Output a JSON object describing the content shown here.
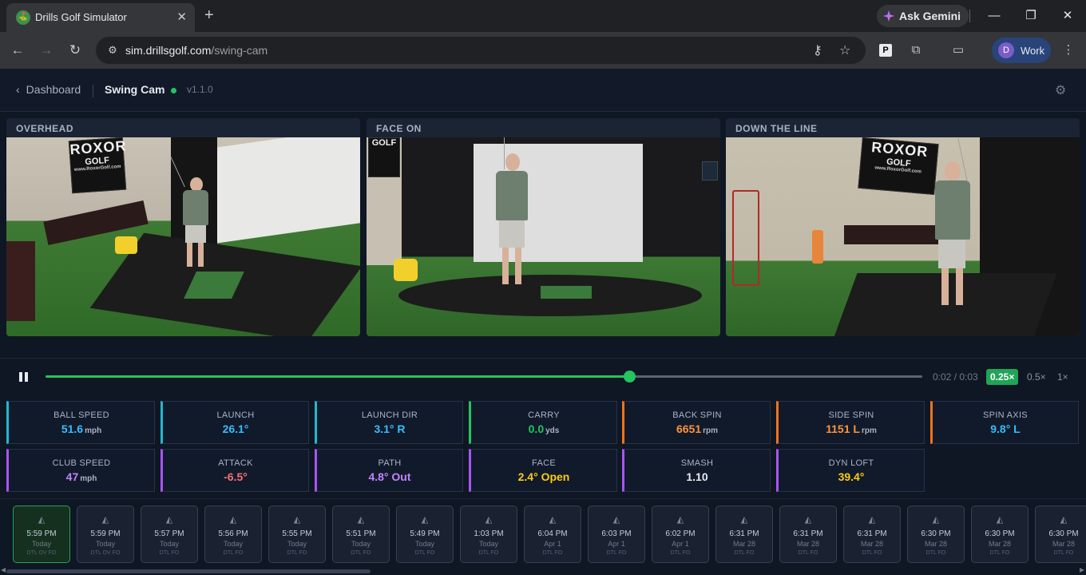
{
  "browser": {
    "tab_title": "Drills Golf Simulator",
    "favicon": "⛳",
    "ask_gemini": "Ask Gemini",
    "url_host": "sim.drillsgolf.com",
    "url_path": "/swing-cam",
    "profile_initial": "D",
    "profile_label": "Work",
    "ext_p": "P"
  },
  "header": {
    "back_label": "Dashboard",
    "title": "Swing Cam",
    "version": "v1.1.0",
    "status_color": "#22c55e"
  },
  "cameras": [
    {
      "label": "OVERHEAD"
    },
    {
      "label": "FACE ON"
    },
    {
      "label": "DOWN THE LINE"
    }
  ],
  "scene_text": {
    "brand": "ROXOR",
    "brand_sub": "GOLF",
    "brand_url": "www.RoxorGolf.com"
  },
  "playback": {
    "progress": 0.666,
    "timecode": "0:02 / 0:03",
    "rates": [
      "0.25×",
      "0.5×",
      "1×"
    ],
    "active_rate": "0.25×",
    "accent": "#22c55e"
  },
  "metrics": [
    {
      "label": "BALL SPEED",
      "value": "51.6",
      "unit": "mph",
      "color": "#38bdf8",
      "accent": "#22b8cf"
    },
    {
      "label": "LAUNCH",
      "value": "26.1°",
      "unit": "",
      "color": "#38bdf8",
      "accent": "#22b8cf"
    },
    {
      "label": "LAUNCH DIR",
      "value": "3.1° R",
      "unit": "",
      "color": "#38bdf8",
      "accent": "#22b8cf"
    },
    {
      "label": "CARRY",
      "value": "0.0",
      "unit": "yds",
      "color": "#22c55e",
      "accent": "#22c55e"
    },
    {
      "label": "BACK SPIN",
      "value": "6651",
      "unit": "rpm",
      "color": "#fb923c",
      "accent": "#f97316"
    },
    {
      "label": "SIDE SPIN",
      "value": "1151 L",
      "unit": "rpm",
      "color": "#fb923c",
      "accent": "#f97316"
    },
    {
      "label": "SPIN AXIS",
      "value": "9.8° L",
      "unit": "",
      "color": "#38bdf8",
      "accent": "#f97316"
    },
    {
      "label": "CLUB SPEED",
      "value": "47",
      "unit": "mph",
      "color": "#c084fc",
      "accent": "#a855f7"
    },
    {
      "label": "ATTACK",
      "value": "-6.5°",
      "unit": "",
      "color": "#f87171",
      "accent": "#a855f7"
    },
    {
      "label": "PATH",
      "value": "4.8° Out",
      "unit": "",
      "color": "#c084fc",
      "accent": "#a855f7"
    },
    {
      "label": "FACE",
      "value": "2.4° Open",
      "unit": "",
      "color": "#facc15",
      "accent": "#a855f7"
    },
    {
      "label": "SMASH",
      "value": "1.10",
      "unit": "",
      "color": "#e6ebf2",
      "accent": "#a855f7"
    },
    {
      "label": "DYN LOFT",
      "value": "39.4°",
      "unit": "",
      "color": "#facc15",
      "accent": "#a855f7"
    }
  ],
  "shots": [
    {
      "time": "5:59 PM",
      "day": "Today",
      "tag": "DTL OV FO",
      "active": true
    },
    {
      "time": "5:59 PM",
      "day": "Today",
      "tag": "DTL OV FO"
    },
    {
      "time": "5:57 PM",
      "day": "Today",
      "tag": "DTL FO"
    },
    {
      "time": "5:56 PM",
      "day": "Today",
      "tag": "DTL FO"
    },
    {
      "time": "5:55 PM",
      "day": "Today",
      "tag": "DTL FO"
    },
    {
      "time": "5:51 PM",
      "day": "Today",
      "tag": "DTL FO"
    },
    {
      "time": "5:49 PM",
      "day": "Today",
      "tag": "DTL FO"
    },
    {
      "time": "1:03 PM",
      "day": "Today",
      "tag": "DTL FO"
    },
    {
      "time": "6:04 PM",
      "day": "Apr 1",
      "tag": "DTL FO"
    },
    {
      "time": "6:03 PM",
      "day": "Apr 1",
      "tag": "DTL FO"
    },
    {
      "time": "6:02 PM",
      "day": "Apr 1",
      "tag": "DTL FO"
    },
    {
      "time": "6:31 PM",
      "day": "Mar 28",
      "tag": "DTL FO"
    },
    {
      "time": "6:31 PM",
      "day": "Mar 28",
      "tag": "DTL FO"
    },
    {
      "time": "6:31 PM",
      "day": "Mar 28",
      "tag": "DTL FO"
    },
    {
      "time": "6:30 PM",
      "day": "Mar 28",
      "tag": "DTL FO"
    },
    {
      "time": "6:30 PM",
      "day": "Mar 28",
      "tag": "DTL FO"
    },
    {
      "time": "6:30 PM",
      "day": "Mar 28",
      "tag": "DTL FO"
    }
  ]
}
